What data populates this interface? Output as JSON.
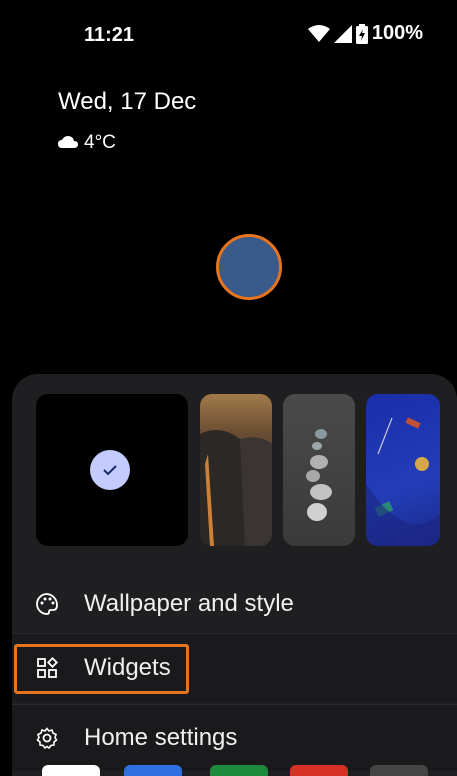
{
  "status_bar": {
    "time": "11:21",
    "battery_text": "100%",
    "icons": [
      "wifi-icon",
      "cell-signal-icon",
      "battery-charging-icon"
    ]
  },
  "glance": {
    "date": "Wed, 17 Dec",
    "temperature": "4°C",
    "weather_icon": "cloud-icon"
  },
  "wallpaper_picker": {
    "thumbnails": [
      "current-wallpaper",
      "waterfall-cliff",
      "stacked-stones",
      "blue-abstract"
    ],
    "selected_index": 0
  },
  "menu": {
    "wallpaper_label": "Wallpaper and style",
    "widgets_label": "Widgets",
    "home_settings_label": "Home settings"
  },
  "colors": {
    "accent_highlight": "#e8741c",
    "sheet_bg": "#1f1f21",
    "check_bg": "#c4cbff"
  }
}
